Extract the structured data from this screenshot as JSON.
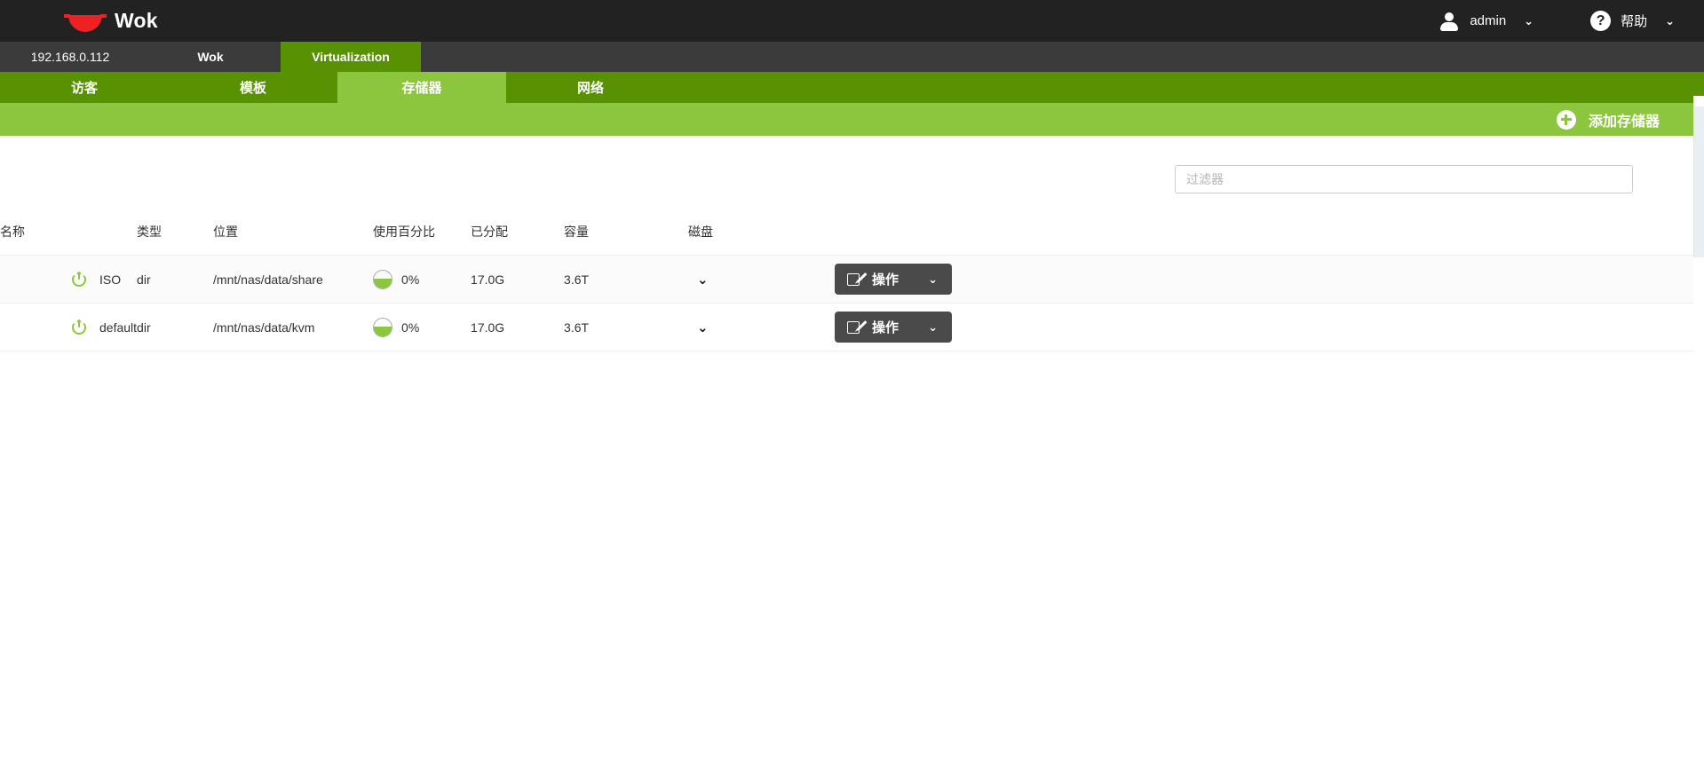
{
  "topbar": {
    "brand": "Wok",
    "logo_color": "#ee2222",
    "user": {
      "icon": "user-icon",
      "label": "admin",
      "caret": "⌄"
    },
    "help": {
      "icon": "question-mark-icon",
      "glyph": "?",
      "label": "帮助",
      "caret": "⌄"
    }
  },
  "nav_primary": {
    "items": [
      {
        "label": "192.168.0.112",
        "active": false,
        "strong": false
      },
      {
        "label": "Wok",
        "active": false,
        "strong": true
      },
      {
        "label": "Virtualization",
        "active": true,
        "strong": true
      }
    ]
  },
  "nav_secondary": {
    "items": [
      {
        "label": "访客",
        "active": false
      },
      {
        "label": "模板",
        "active": false
      },
      {
        "label": "存储器",
        "active": true
      },
      {
        "label": "网络",
        "active": false
      }
    ]
  },
  "actionbar": {
    "add_icon": "plus-circle-icon",
    "add_label": "添加存储器",
    "background": "#8cc63e"
  },
  "filter": {
    "placeholder": "过滤器",
    "value": ""
  },
  "table": {
    "columns": [
      "名称",
      "类型",
      "位置",
      "使用百分比",
      "已分配",
      "容量",
      "磁盘",
      ""
    ],
    "rows": [
      {
        "state_icon": "power-icon",
        "name": "ISO",
        "type": "dir",
        "location": "/mnt/nas/data/share",
        "usage": "0%",
        "allocated": "17.0G",
        "capacity": "3.6T",
        "disk_caret": "⌄",
        "action_icon": "edit-square-icon",
        "action_label": "操作",
        "action_caret": "⌄"
      },
      {
        "state_icon": "power-icon",
        "name": "default",
        "type": "dir",
        "location": "/mnt/nas/data/kvm",
        "usage": "0%",
        "allocated": "17.0G",
        "capacity": "3.6T",
        "disk_caret": "⌄",
        "action_icon": "edit-square-icon",
        "action_label": "操作",
        "action_caret": "⌄"
      }
    ]
  },
  "colors": {
    "topbar_bg": "#222222",
    "nav1_bg": "#3b3b3b",
    "nav_green_dark": "#589102",
    "nav_green_light": "#8cc63e",
    "action_button_bg": "#4a4a4a",
    "power_green": "#8cc63e"
  }
}
